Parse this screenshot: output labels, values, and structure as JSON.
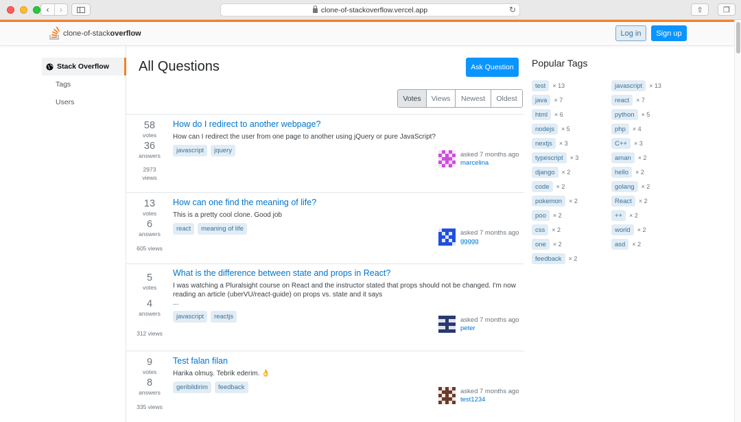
{
  "browser": {
    "url": "clone-of-stackoverflow.vercel.app"
  },
  "header": {
    "logo_prefix": "clone-of-stack",
    "logo_suffix": "overflow",
    "login_label": "Log in",
    "signup_label": "Sign up"
  },
  "sidebar": {
    "items": [
      {
        "label": "Stack Overflow",
        "active": true
      },
      {
        "label": "Tags"
      },
      {
        "label": "Users"
      }
    ]
  },
  "main": {
    "title": "All Questions",
    "ask_label": "Ask Question",
    "filters": [
      {
        "label": "Votes",
        "active": true
      },
      {
        "label": "Views"
      },
      {
        "label": "Newest"
      },
      {
        "label": "Oldest"
      }
    ],
    "questions": [
      {
        "votes": "58",
        "votes_label": "votes",
        "answers": "36",
        "answers_label": "answers",
        "views": "2973",
        "views_label": "views",
        "title": "How do I redirect to another webpage?",
        "excerpt": "How can I redirect the user from one page to another using jQuery or pure JavaScript?",
        "tags": [
          "javascript",
          "jquery"
        ],
        "asked": "asked 7 months ago",
        "user": "marcelina",
        "avatar_color": "#d04ce0"
      },
      {
        "votes": "13",
        "votes_label": "votes",
        "answers": "6",
        "answers_label": "answers",
        "views": "605 views",
        "title": "How can one find the meaning of life?",
        "excerpt": "This is a pretty cool clone. Good job",
        "tags": [
          "react",
          "meaning of life"
        ],
        "asked": "asked 7 months ago",
        "user": "ggggg",
        "avatar_color": "#1f4fe0"
      },
      {
        "votes": "5",
        "votes_label": "votes",
        "answers": "4",
        "answers_label": "answers",
        "views": "312 views",
        "title": "What is the difference between state and props in React?",
        "excerpt": "I was watching a Pluralsight course on React and the instructor stated that props should not be changed. I'm now reading an article (uberVU/react-guide) on props vs. state and it says",
        "excerpt_more": "...",
        "tags": [
          "javascript",
          "reactjs"
        ],
        "asked": "asked 7 months ago",
        "user": "peter",
        "avatar_color": "#2a3a6e"
      },
      {
        "votes": "9",
        "votes_label": "votes",
        "answers": "8",
        "answers_label": "answers",
        "views": "335 views",
        "title": "Test falan filan",
        "excerpt": "Harika olmuş. Tebrik ederim. 👌",
        "tags": [
          "geribildirim",
          "feedback"
        ],
        "asked": "asked 7 months ago",
        "user": "test1234",
        "avatar_color": "#6b3a2a"
      }
    ]
  },
  "popular_tags": {
    "title": "Popular Tags",
    "left": [
      {
        "name": "test",
        "count": "× 13"
      },
      {
        "name": "java",
        "count": "× 7"
      },
      {
        "name": "html",
        "count": "× 6"
      },
      {
        "name": "nodejs",
        "count": "× 5"
      },
      {
        "name": "nextjs",
        "count": "× 3"
      },
      {
        "name": "typescript",
        "count": "× 3"
      },
      {
        "name": "django",
        "count": "× 2"
      },
      {
        "name": "code",
        "count": "× 2"
      },
      {
        "name": "pokemon",
        "count": "× 2"
      },
      {
        "name": "poo",
        "count": "× 2"
      },
      {
        "name": "css",
        "count": "× 2"
      },
      {
        "name": "one",
        "count": "× 2"
      },
      {
        "name": "feedback",
        "count": "× 2"
      }
    ],
    "right": [
      {
        "name": "javascript",
        "count": "× 13"
      },
      {
        "name": "react",
        "count": "× 7"
      },
      {
        "name": "python",
        "count": "× 5"
      },
      {
        "name": "php",
        "count": "× 4"
      },
      {
        "name": "C++",
        "count": "× 3"
      },
      {
        "name": "aman",
        "count": "× 2"
      },
      {
        "name": "hello",
        "count": "× 2"
      },
      {
        "name": "golang",
        "count": "× 2"
      },
      {
        "name": "React",
        "count": "× 2"
      },
      {
        "name": "++",
        "count": "× 2"
      },
      {
        "name": "world",
        "count": "× 2"
      },
      {
        "name": "asd",
        "count": "× 2"
      }
    ]
  },
  "colors": {
    "accent": "#f48024",
    "primary": "#0a95ff",
    "link": "#0074cc",
    "tag_bg": "#e1ecf4",
    "tag_fg": "#39739d"
  }
}
